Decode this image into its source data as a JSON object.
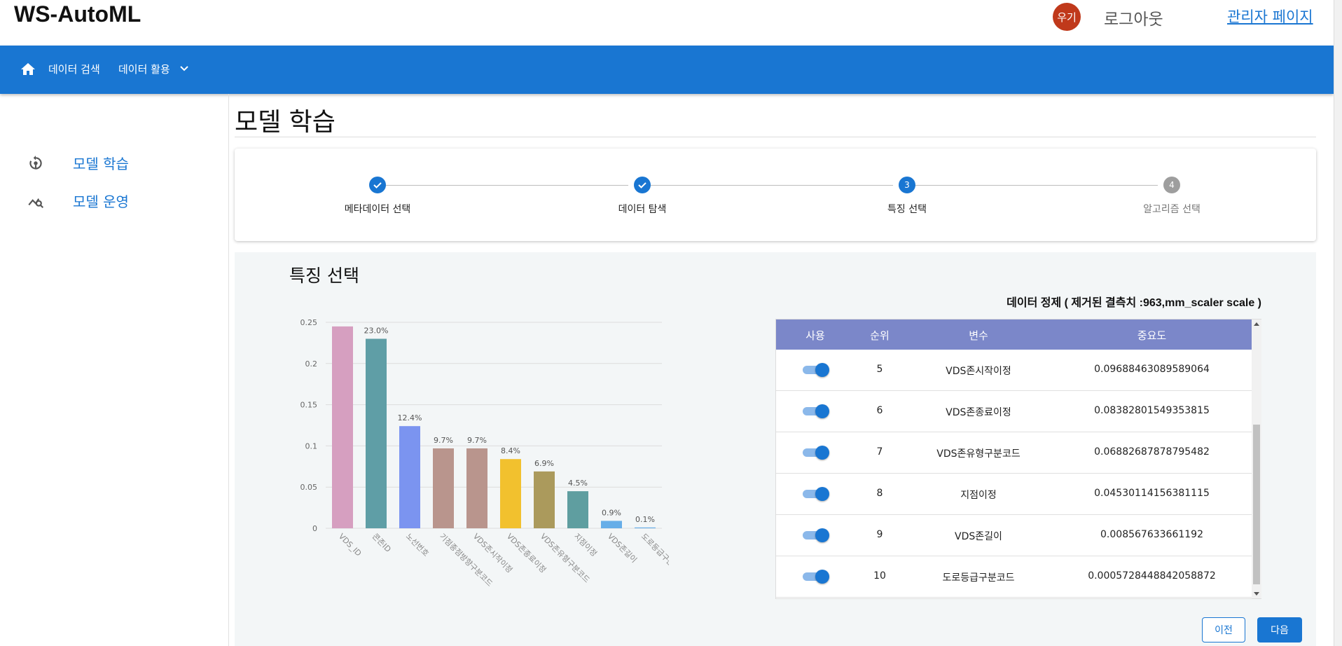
{
  "header": {
    "brand": "WS-AutoML",
    "avatar_text": "우기",
    "logout_label": "로그아웃",
    "admin_label": "관리자 페이지"
  },
  "nav": {
    "items": [
      {
        "label": "데이터 검색"
      },
      {
        "label": "데이터 활용"
      }
    ]
  },
  "sidebar": {
    "items": [
      {
        "label": "모델 학습",
        "icon": "model-train-icon"
      },
      {
        "label": "모델 운영",
        "icon": "query-stats-icon"
      }
    ]
  },
  "page": {
    "title": "모델 학습"
  },
  "stepper": {
    "steps": [
      {
        "number": "1",
        "label": "메타데이터 선택",
        "state": "done"
      },
      {
        "number": "2",
        "label": "데이터 탐색",
        "state": "done"
      },
      {
        "number": "3",
        "label": "특징 선택",
        "state": "active"
      },
      {
        "number": "4",
        "label": "알고리즘 선택",
        "state": "todo"
      }
    ]
  },
  "section": {
    "title": "특징 선택"
  },
  "chart_data": {
    "type": "bar",
    "categories": [
      "VDS_ID",
      "콘존ID",
      "노선번호",
      "기점종점방향구분코드",
      "VDS존시작이정",
      "VDS존종료이정",
      "VDS존유형구분코드",
      "지점이정",
      "VDS존길이",
      "도로등급구분코드"
    ],
    "values": [
      0.245,
      0.23,
      0.124,
      0.097,
      0.097,
      0.084,
      0.069,
      0.045,
      0.009,
      0.001
    ],
    "data_labels": [
      "",
      "23.0%",
      "12.4%",
      "9.7%",
      "9.7%",
      "8.4%",
      "6.9%",
      "4.5%",
      "0.9%",
      "0.1%"
    ],
    "colors": [
      "#d69fc0",
      "#5f9ea6",
      "#7b94f0",
      "#b9958d",
      "#b9958d",
      "#f2c12e",
      "#ab9a5c",
      "#5f9ea0",
      "#67aee8",
      "#67aee8"
    ],
    "ylim": [
      0,
      0.25
    ],
    "yticks": [
      "0",
      "0.05",
      "0.1",
      "0.15",
      "0.2",
      "0.25"
    ],
    "grid": true,
    "title": "",
    "xlabel": "",
    "ylabel": ""
  },
  "table": {
    "caption": "데이터 정제 ( 제거된 결측치 :963,mm_scaler scale )",
    "headers": [
      "사용",
      "순위",
      "변수",
      "중요도"
    ],
    "rows": [
      {
        "rank": "5",
        "name": "VDS존시작이정",
        "importance": "0.09688463089589064"
      },
      {
        "rank": "6",
        "name": "VDS존종료이정",
        "importance": "0.08382801549353815"
      },
      {
        "rank": "7",
        "name": "VDS존유형구분코드",
        "importance": "0.06882687878795482"
      },
      {
        "rank": "8",
        "name": "지점이정",
        "importance": "0.04530114156381115"
      },
      {
        "rank": "9",
        "name": "VDS존길이",
        "importance": "0.008567633661192"
      },
      {
        "rank": "10",
        "name": "도로등급구분코드",
        "importance": "0.0005728448842058872"
      }
    ]
  },
  "buttons": {
    "prev": "이전",
    "next": "다음"
  },
  "colors": {
    "primary": "#1976d2",
    "table_header": "#7b87c9",
    "avatar": "#c0391b"
  }
}
